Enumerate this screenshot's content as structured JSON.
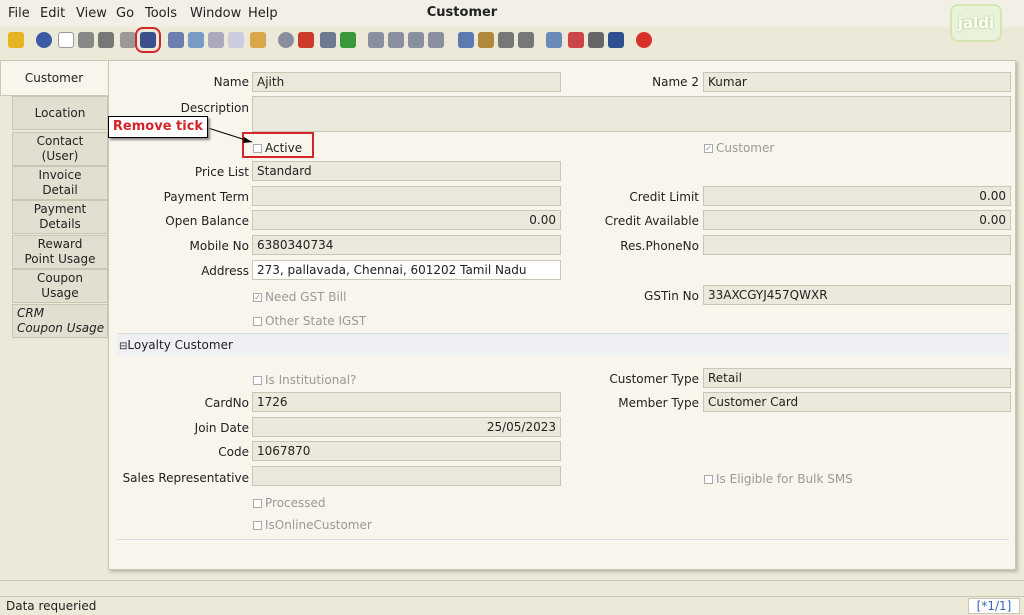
{
  "menu": {
    "file": "File",
    "edit": "Edit",
    "view": "View",
    "go": "Go",
    "tools": "Tools",
    "window": "Window",
    "help": "Help"
  },
  "window_title": "Customer",
  "logo_text": "jaldi",
  "tabs": [
    {
      "label": "Customer"
    },
    {
      "label": "Location"
    },
    {
      "label": "Contact\n(User)"
    },
    {
      "label": "Invoice\nDetail"
    },
    {
      "label": "Payment\nDetails"
    },
    {
      "label": "Reward\nPoint Usage"
    },
    {
      "label": "Coupon\nUsage"
    },
    {
      "label": "CRM\nCoupon Usage"
    }
  ],
  "form": {
    "name_label": "Name",
    "name_value": "Ajith",
    "name2_label": "Name 2",
    "name2_value": "Kumar",
    "description_label": "Description",
    "description_value": "",
    "active_label": "Active",
    "active_checked": false,
    "customer_label": "Customer",
    "customer_checked": true,
    "price_list_label": "Price List",
    "price_list_value": "Standard",
    "payment_term_label": "Payment Term",
    "payment_term_value": "",
    "credit_limit_label": "Credit Limit",
    "credit_limit_value": "0.00",
    "open_balance_label": "Open Balance",
    "open_balance_value": "0.00",
    "credit_available_label": "Credit Available",
    "credit_available_value": "0.00",
    "mobile_label": "Mobile No",
    "mobile_value": "6380340734",
    "res_phone_label": "Res.PhoneNo",
    "res_phone_value": "",
    "address_label": "Address",
    "address_value": "273, pallavada, Chennai,  601202 Tamil Nadu",
    "need_gst_label": "Need GST Bill",
    "need_gst_checked": true,
    "gstin_label": "GSTin No",
    "gstin_value": "33AXCGYJ457QWXR",
    "other_state_label": "Other State IGST",
    "other_state_checked": false
  },
  "loyalty": {
    "section_label": "Loyalty Customer",
    "institutional_label": "Is Institutional?",
    "customer_type_label": "Customer Type",
    "customer_type_value": "Retail",
    "cardno_label": "CardNo",
    "cardno_value": "1726",
    "member_type_label": "Member Type",
    "member_type_value": "Customer Card",
    "join_date_label": "Join Date",
    "join_date_value": "25/05/2023",
    "code_label": "Code",
    "code_value": "1067870",
    "sales_rep_label": "Sales Representative",
    "sales_rep_value": "",
    "bulk_sms_label": "Is Eligible for Bulk SMS",
    "processed_label": "Processed",
    "online_label": "IsOnlineCustomer"
  },
  "annotation": {
    "callout": "Remove tick"
  },
  "status": {
    "text": "Data requeried",
    "page": "[*1/1]"
  },
  "colors": {
    "accent_red": "#d3262b",
    "field_bg": "#ebe9db",
    "panel_bg": "#f7f5ec"
  }
}
